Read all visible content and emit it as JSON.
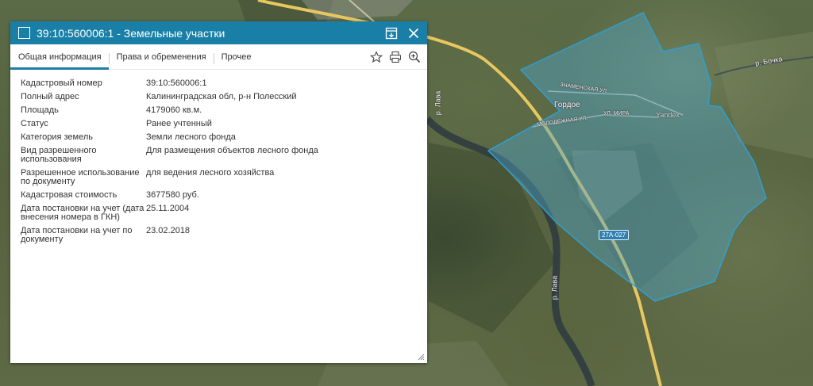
{
  "window": {
    "title": "39:10:560006:1 - Земельные участки",
    "tabs": [
      {
        "label": "Общая информация",
        "active": true
      },
      {
        "label": "Права и обременения",
        "active": false
      },
      {
        "label": "Прочее",
        "active": false
      }
    ]
  },
  "properties": [
    {
      "key": "Кадастровый номер",
      "value": "39:10:560006:1"
    },
    {
      "key": "Полный адрес",
      "value": "Калининградская обл, р-н Полесский"
    },
    {
      "key": "Площадь",
      "value": "4179060 кв.м."
    },
    {
      "key": "Статус",
      "value": "Ранее учтенный"
    },
    {
      "key": "Категория земель",
      "value": "Земли лесного фонда"
    },
    {
      "key": "Вид разрешенного использования",
      "value": "Для размещения объектов лесного фонда"
    },
    {
      "key": "Разрешенное использование по документу",
      "value": "для ведения лесного хозяйства"
    },
    {
      "key": "Кадастровая стоимость",
      "value": "3677580 руб."
    },
    {
      "key": "Дата постановки на учет (дата внесения номера в ГКН)",
      "value": "25.11.2004"
    },
    {
      "key": "Дата постановки на учет по документу",
      "value": "23.02.2018"
    }
  ],
  "map": {
    "labels": {
      "river_bochka": "р. Бочка",
      "river_lava_1": "р. Лава",
      "river_lava_2": "р. Лава",
      "town": "Гордое",
      "street_znamenskaya": "ЗНАМЕНСКАЯ УЛ.",
      "street_molodezhnaya": "МОЛОДЁЖНАЯ УЛ.",
      "street_mira": "УЛ. МИРА",
      "road_number": "27А-027",
      "yandex": "Yandex"
    }
  },
  "colors": {
    "accent": "#1a7fa7",
    "parcel_fill": "#4fa3c8",
    "parcel_stroke": "#2f9fd0",
    "road": "#e8c760"
  }
}
